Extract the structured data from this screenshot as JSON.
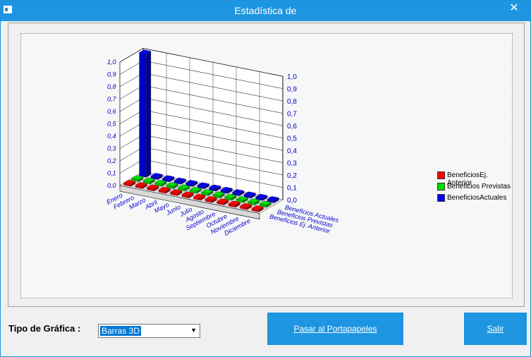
{
  "window": {
    "title": "Estadística de",
    "close_glyph": "✕"
  },
  "form": {
    "chart_type_label": "Tipo de Gráfica :",
    "chart_type_value": "Barras 3D",
    "copy_button": "Pasar al Portapapeles",
    "exit_button": "Salir"
  },
  "chart_data": {
    "type": "bar",
    "categories": [
      "Enero",
      "Febrero",
      "Marzo",
      "Abril",
      "Mayo",
      "Junio",
      "Julio",
      "Agosto",
      "Septiembre",
      "Octubre",
      "Noviembre",
      "Diciembre"
    ],
    "series": [
      {
        "name": "BeneficiosEj. Anterior",
        "values": [
          0,
          0,
          0,
          0,
          0,
          0,
          0,
          0,
          0,
          0,
          0,
          0
        ],
        "color": "#ff0000"
      },
      {
        "name": "Beneficios Previstas",
        "values": [
          0,
          0,
          0,
          0,
          0,
          0,
          0,
          0,
          0,
          0,
          0,
          0
        ],
        "color": "#00dd00"
      },
      {
        "name": "BeneficiosActuales",
        "values": [
          1,
          0,
          0,
          0,
          0,
          0,
          0,
          0,
          0,
          0,
          0,
          0
        ],
        "color": "#0000ee"
      }
    ],
    "depth_labels": [
      "Beneficios Actuales",
      "Beneficios Previstas",
      "Beneficios Ej. Anterior"
    ],
    "ylim": [
      0,
      1
    ],
    "yticks": [
      "0.0",
      "0.1",
      "0.2",
      "0.3",
      "0.4",
      "0.5",
      "0.6",
      "0.7",
      "0.8",
      "0.9",
      "1.0"
    ],
    "left_yticks": [
      "0.0",
      "0.1",
      "0.2",
      "0.3",
      "0.4",
      "0.5",
      "0.6",
      "0.7",
      "0.8",
      "0.9",
      "1.0"
    ],
    "legend_position": "right",
    "grid": true
  }
}
